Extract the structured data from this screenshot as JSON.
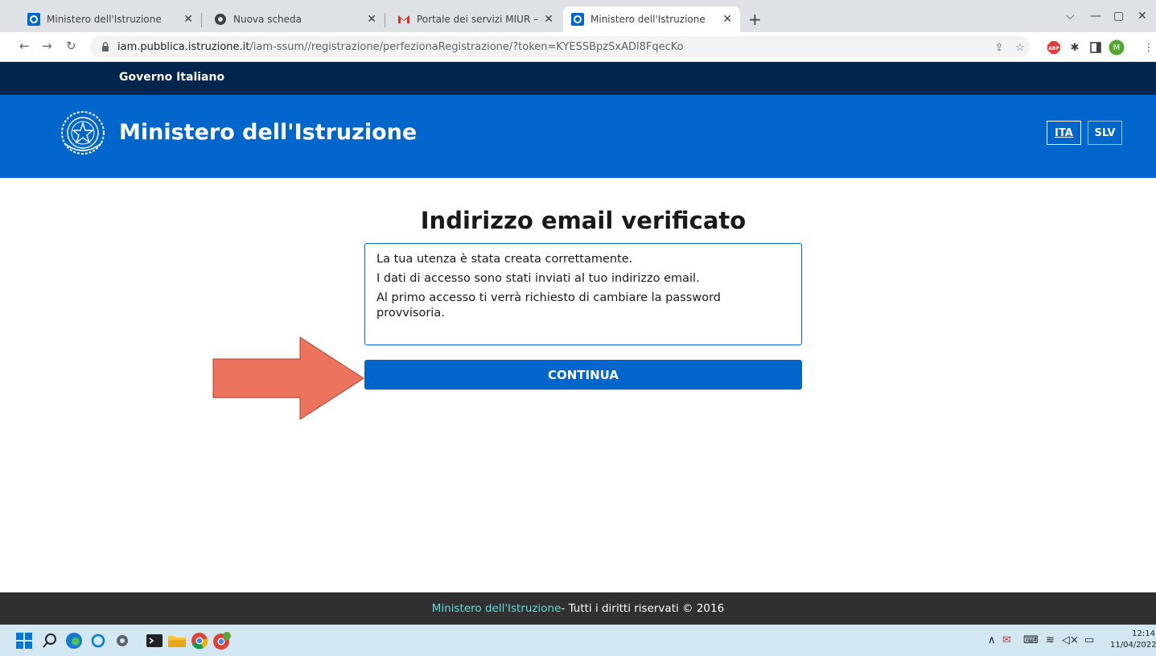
{
  "browser": {
    "tabs": [
      {
        "title": "Ministero dell'Istruzione",
        "icon": "ministry-favicon-icon",
        "active": false
      },
      {
        "title": "Nuova scheda",
        "icon": "chrome-favicon-icon",
        "active": false
      },
      {
        "title": "Portale dei servizi MIUR – Confer",
        "icon": "gmail-favicon-icon",
        "active": false
      },
      {
        "title": "Ministero dell'Istruzione",
        "icon": "ministry-favicon-icon",
        "active": true
      }
    ],
    "url_host": "iam.pubblica.istruzione.it",
    "url_path": "/iam-ssum//registrazione/perfezionaRegistrazione/?token=KYESSBpzSxADl8FqecKo",
    "profile_initial": "M"
  },
  "site": {
    "gov_label": "Governo Italiano",
    "title": "Ministero dell'Istruzione",
    "languages": [
      "ITA",
      "SLV"
    ]
  },
  "content": {
    "heading": "Indirizzo email verificato",
    "messages": [
      "La tua utenza è stata creata correttamente.",
      "I dati di accesso sono stati inviati al tuo indirizzo email.",
      "Al primo accesso ti verrà richiesto di cambiare la password provvisoria."
    ],
    "button_label": "CONTINUA"
  },
  "footer": {
    "link": "Ministero dell'Istruzione",
    "text": " - Tutti i diritti riservati © 2016"
  },
  "taskbar": {
    "time": "12:14",
    "date": "11/04/2022"
  },
  "colors": {
    "gov_bar": "#01254c",
    "header": "#0066cc",
    "button": "#0066cc",
    "arrow": "#ec735e",
    "footer": "#303030",
    "footer_link": "#65dcdf"
  }
}
